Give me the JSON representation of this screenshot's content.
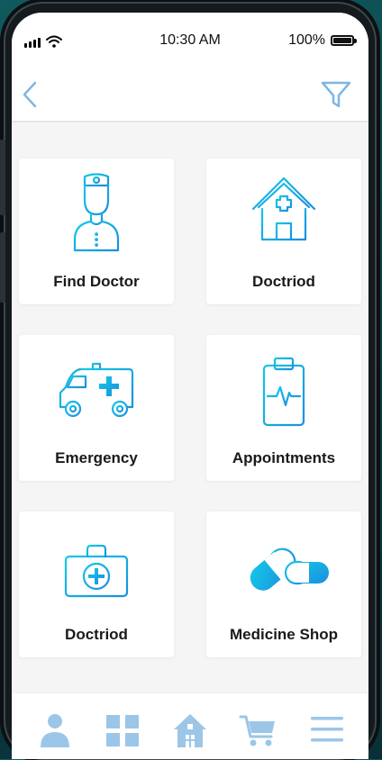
{
  "status_bar": {
    "time": "10:30 AM",
    "battery_percent": "100%",
    "signal_icon": "signal-bars-icon",
    "wifi_icon": "wifi-icon",
    "battery_icon": "battery-icon",
    "battery_level": 1.0
  },
  "nav": {
    "back_icon": "chevron-left-icon",
    "filter_icon": "filter-funnel-icon"
  },
  "theme": {
    "accent_cyan": "#14c8e6",
    "accent_blue": "#1a8fe0",
    "nav_icon_color": "#9cc6e8",
    "card_background": "#ffffff",
    "screen_background": "#f5f5f5"
  },
  "cards": [
    {
      "label": "Find Doctor",
      "icon": "doctor-icon"
    },
    {
      "label": "Doctriod",
      "icon": "hospital-house-icon"
    },
    {
      "label": "Emergency",
      "icon": "ambulance-icon"
    },
    {
      "label": "Appointments",
      "icon": "clipboard-heartbeat-icon"
    },
    {
      "label": "Doctriod",
      "icon": "first-aid-kit-icon"
    },
    {
      "label": "Medicine Shop",
      "icon": "pills-icon"
    }
  ],
  "bottom_nav": [
    {
      "icon": "profile-icon"
    },
    {
      "icon": "grid-icon"
    },
    {
      "icon": "home-icon"
    },
    {
      "icon": "cart-icon"
    },
    {
      "icon": "menu-icon"
    }
  ]
}
